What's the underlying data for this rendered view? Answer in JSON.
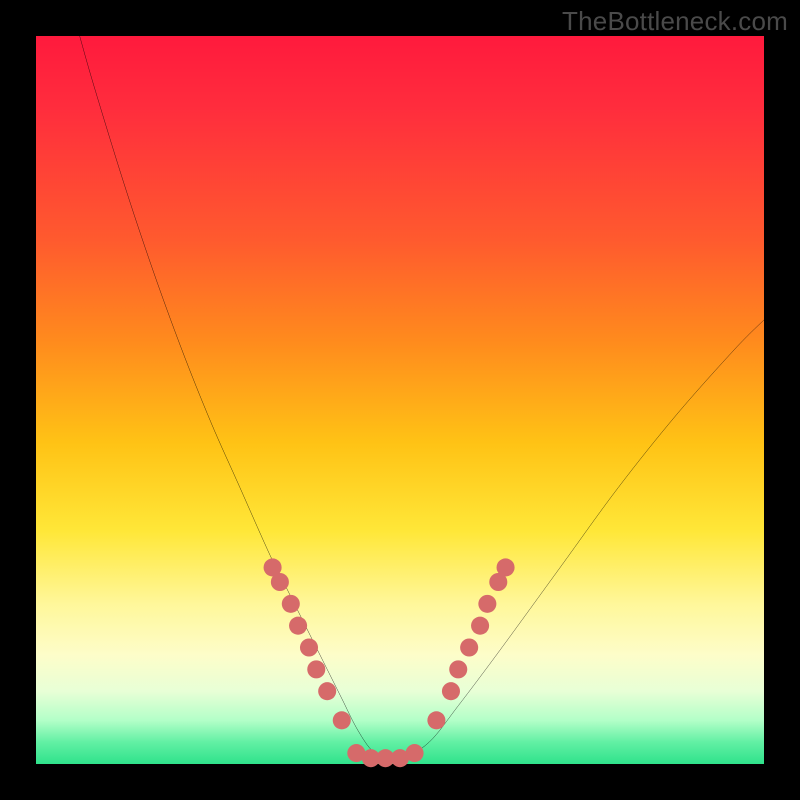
{
  "watermark": "TheBottleneck.com",
  "chart_data": {
    "type": "line",
    "title": "",
    "xlabel": "",
    "ylabel": "",
    "xlim": [
      0,
      100
    ],
    "ylim": [
      0,
      100
    ],
    "grid": false,
    "legend": false,
    "series": [
      {
        "name": "bottleneck-curve",
        "x": [
          6,
          8,
          12,
          16,
          20,
          24,
          28,
          32,
          34,
          36,
          38,
          40,
          42,
          44,
          46,
          48,
          50,
          54,
          58,
          64,
          72,
          80,
          88,
          96,
          100
        ],
        "y": [
          100,
          93,
          80,
          68,
          57,
          47,
          38,
          29,
          25,
          21,
          17,
          13,
          9,
          5,
          2,
          0.5,
          0.5,
          3,
          8,
          16,
          27,
          38,
          48,
          57,
          61
        ],
        "color": "#000000"
      }
    ],
    "markers": [
      {
        "name": "left-branch-dots",
        "shape": "circle",
        "color": "#d66a6a",
        "radius_approx": 9,
        "points": [
          {
            "x": 32.5,
            "y": 27
          },
          {
            "x": 33.5,
            "y": 25
          },
          {
            "x": 35,
            "y": 22
          },
          {
            "x": 36,
            "y": 19
          },
          {
            "x": 37.5,
            "y": 16
          },
          {
            "x": 38.5,
            "y": 13
          },
          {
            "x": 40,
            "y": 10
          },
          {
            "x": 42,
            "y": 6
          }
        ]
      },
      {
        "name": "valley-floor-dots",
        "shape": "circle",
        "color": "#d66a6a",
        "radius_approx": 9,
        "points": [
          {
            "x": 44,
            "y": 1.5
          },
          {
            "x": 46,
            "y": 0.8
          },
          {
            "x": 48,
            "y": 0.8
          },
          {
            "x": 50,
            "y": 0.8
          },
          {
            "x": 52,
            "y": 1.5
          }
        ]
      },
      {
        "name": "right-branch-dots",
        "shape": "circle",
        "color": "#d66a6a",
        "radius_approx": 9,
        "points": [
          {
            "x": 55,
            "y": 6
          },
          {
            "x": 57,
            "y": 10
          },
          {
            "x": 58,
            "y": 13
          },
          {
            "x": 59.5,
            "y": 16
          },
          {
            "x": 61,
            "y": 19
          },
          {
            "x": 62,
            "y": 22
          },
          {
            "x": 63.5,
            "y": 25
          },
          {
            "x": 64.5,
            "y": 27
          }
        ]
      }
    ]
  }
}
